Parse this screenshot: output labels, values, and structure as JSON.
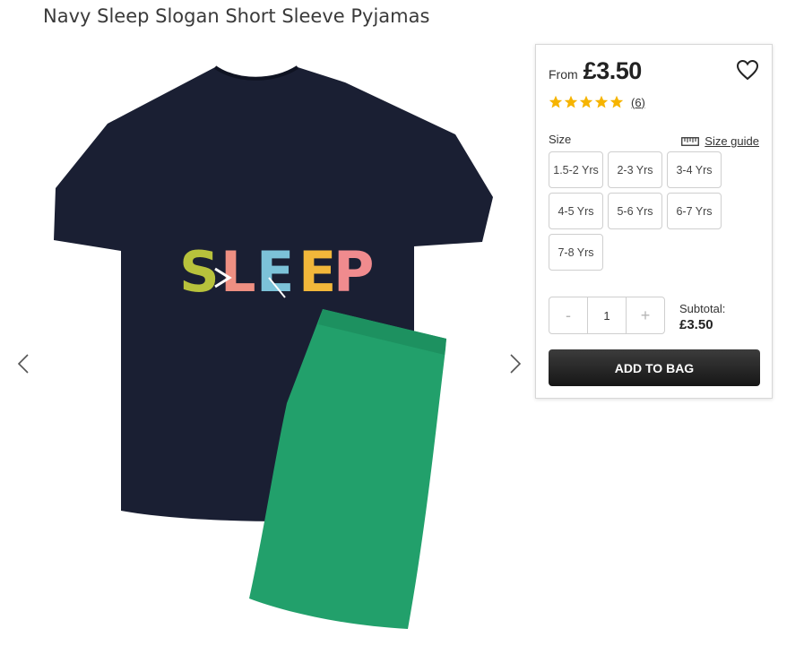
{
  "product": {
    "title": "Navy Sleep Slogan Short Sleeve Pyjamas",
    "price_prefix": "From",
    "price": "£3.50",
    "rating": {
      "stars": 5,
      "max": 5,
      "review_count": "(6)"
    },
    "graphic_text": "SLEEP"
  },
  "size": {
    "label": "Size",
    "guide_label": "Size guide",
    "options": [
      "1.5-2 Yrs",
      "2-3 Yrs",
      "3-4 Yrs",
      "4-5 Yrs",
      "5-6 Yrs",
      "6-7 Yrs",
      "7-8 Yrs"
    ]
  },
  "quantity": {
    "minus": "-",
    "value": "1",
    "plus": "+"
  },
  "subtotal": {
    "label": "Subtotal:",
    "value": "£3.50"
  },
  "actions": {
    "add_to_bag": "ADD TO BAG"
  },
  "colors": {
    "tshirt": "#1a1f33",
    "shorts": "#22a06b",
    "star": "#f6b400",
    "button": "#222222"
  },
  "icons": [
    "chevron-left-icon",
    "chevron-right-icon",
    "heart-icon",
    "star-icon",
    "ruler-icon"
  ]
}
